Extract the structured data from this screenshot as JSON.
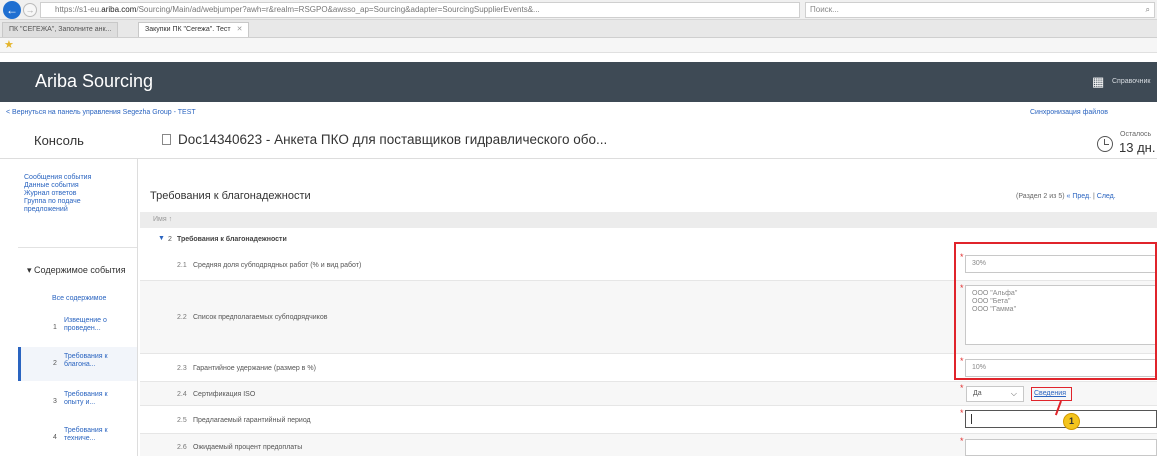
{
  "browser": {
    "url_prefix": "https://s1-eu.",
    "url_domain": "ariba.com",
    "url_rest": "/Sourcing/Main/ad/webjumper?awh=r&realm=RSGPO&awsso_ap=Sourcing&adapter=SourcingSupplierEvents&...",
    "search_placeholder": "Поиск...",
    "tabs": [
      {
        "label": "ПК \"СЕГЕЖА\", Заполните анк..."
      },
      {
        "label": "Закупки ПК \"Сегежа\". Тест"
      }
    ]
  },
  "header": {
    "app_title": "Ariba Sourcing",
    "right_label": "Справочник"
  },
  "nav": {
    "back_link": "< Вернуться на панель управления Segezha Group - TEST",
    "sync_link": "Синхронизация файлов"
  },
  "page": {
    "console_title": "Консоль",
    "doc_title": "Doc14340623 - Анкета ПКО для поставщиков гидравлического обо...",
    "remaining_label": "Осталось",
    "remaining_value": "13 дн."
  },
  "sidebar": {
    "links": [
      "Сообщения события",
      "Данные события",
      "Журнал ответов",
      "Группа по подаче",
      "предложений"
    ],
    "contents_title": "▾ Содержимое события",
    "all_contents": "Все содержимое",
    "items": [
      {
        "num": "1",
        "line1": "Извещение о",
        "line2": "проведен..."
      },
      {
        "num": "2",
        "line1": "Требования к",
        "line2": "благона..."
      },
      {
        "num": "3",
        "line1": "Требования к",
        "line2": "опыту и..."
      },
      {
        "num": "4",
        "line1": "Требования к",
        "line2": "техниче..."
      }
    ]
  },
  "section": {
    "title": "Требования к благонадежности",
    "pager_text": "(Раздел 2 из 5)",
    "prev": "« Пред.",
    "sep": "|",
    "next": "След.",
    "col_name": "Имя ↑",
    "group_num": "2",
    "group_title": "Требования к благонадежности"
  },
  "rows": [
    {
      "num": "2.1",
      "question": "Средняя доля субподрядных работ (% и вид работ)",
      "value": "30%"
    },
    {
      "num": "2.2",
      "question": "Список предполагаемых субподрядчиков",
      "value_lines": [
        "ООО \"Альфа\"",
        "ООО \"Бета\"",
        "ООО \"Гамма\""
      ]
    },
    {
      "num": "2.3",
      "question": "Гарантийное удержание (размер в %)",
      "value": "10%"
    },
    {
      "num": "2.4",
      "question": "Сертификация ISO",
      "select_value": "Да",
      "details": "Сведения"
    },
    {
      "num": "2.5",
      "question": "Предлагаемый гарантийный период",
      "value": ""
    },
    {
      "num": "2.6",
      "question": "Ожидаемый процент предоплаты",
      "value": ""
    }
  ],
  "annotation": {
    "callout_number": "1",
    "highlight_color": "#e0242b",
    "callout_color": "#f3c41d"
  }
}
